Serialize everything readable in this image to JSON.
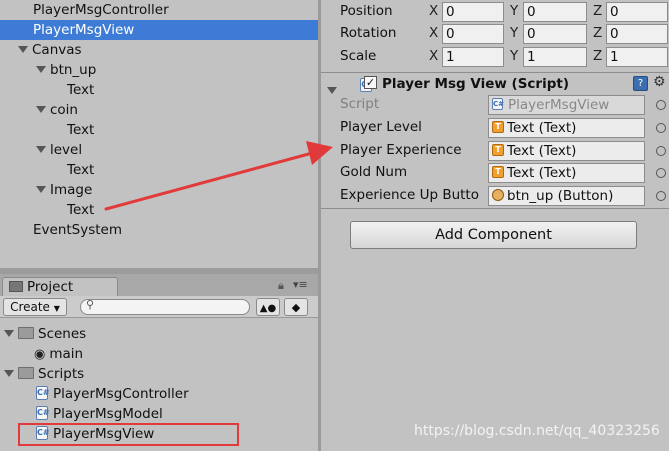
{
  "hierarchy": {
    "items": [
      {
        "label": "PlayerMsgController",
        "indent": 0,
        "foldout": false,
        "selected": false
      },
      {
        "label": "PlayerMsgView",
        "indent": 0,
        "foldout": false,
        "selected": true
      },
      {
        "label": "Canvas",
        "indent": 0,
        "foldout": true,
        "selected": false
      },
      {
        "label": "btn_up",
        "indent": 1,
        "foldout": true,
        "selected": false
      },
      {
        "label": "Text",
        "indent": 2,
        "foldout": false,
        "selected": false
      },
      {
        "label": "coin",
        "indent": 1,
        "foldout": true,
        "selected": false
      },
      {
        "label": "Text",
        "indent": 2,
        "foldout": false,
        "selected": false
      },
      {
        "label": "level",
        "indent": 1,
        "foldout": true,
        "selected": false
      },
      {
        "label": "Text",
        "indent": 2,
        "foldout": false,
        "selected": false
      },
      {
        "label": "Image",
        "indent": 1,
        "foldout": true,
        "selected": false
      },
      {
        "label": "Text",
        "indent": 2,
        "foldout": false,
        "selected": false
      },
      {
        "label": "EventSystem",
        "indent": 0,
        "foldout": false,
        "selected": false
      }
    ]
  },
  "project": {
    "tab_label": "Project",
    "create_label": "Create",
    "search_placeholder": "",
    "tree": [
      {
        "label": "Scenes",
        "type": "folder",
        "indent": 0
      },
      {
        "label": "main",
        "type": "scene",
        "indent": 1
      },
      {
        "label": "Scripts",
        "type": "folder",
        "indent": 0
      },
      {
        "label": "PlayerMsgController",
        "type": "script",
        "indent": 1
      },
      {
        "label": "PlayerMsgModel",
        "type": "script",
        "indent": 1
      },
      {
        "label": "PlayerMsgView",
        "type": "script",
        "indent": 1
      }
    ]
  },
  "inspector": {
    "transform": {
      "rows": [
        {
          "label": "Position",
          "x": "0",
          "y": "0",
          "z": "0"
        },
        {
          "label": "Rotation",
          "x": "0",
          "y": "0",
          "z": "0"
        },
        {
          "label": "Scale",
          "x": "1",
          "y": "1",
          "z": "1"
        }
      ],
      "axis_x": "X",
      "axis_y": "Y",
      "axis_z": "Z"
    },
    "component": {
      "title": "Player Msg View (Script)",
      "script_label": "Script",
      "script_value": "PlayerMsgView",
      "fields": [
        {
          "label": "Player Level",
          "value": "Text (Text)",
          "kind": "text"
        },
        {
          "label": "Player Experience",
          "value": "Text (Text)",
          "kind": "text"
        },
        {
          "label": "Gold Num",
          "value": "Text (Text)",
          "kind": "text"
        },
        {
          "label": "Experience Up Butto",
          "value": "btn_up (Button)",
          "kind": "button"
        }
      ]
    },
    "add_component_label": "Add Component"
  },
  "watermark": "https://blog.csdn.net/qq_40323256",
  "colors": {
    "selection": "#3e7bd6",
    "panel": "#c2c2c2",
    "annotation_red": "#e23a3a"
  }
}
